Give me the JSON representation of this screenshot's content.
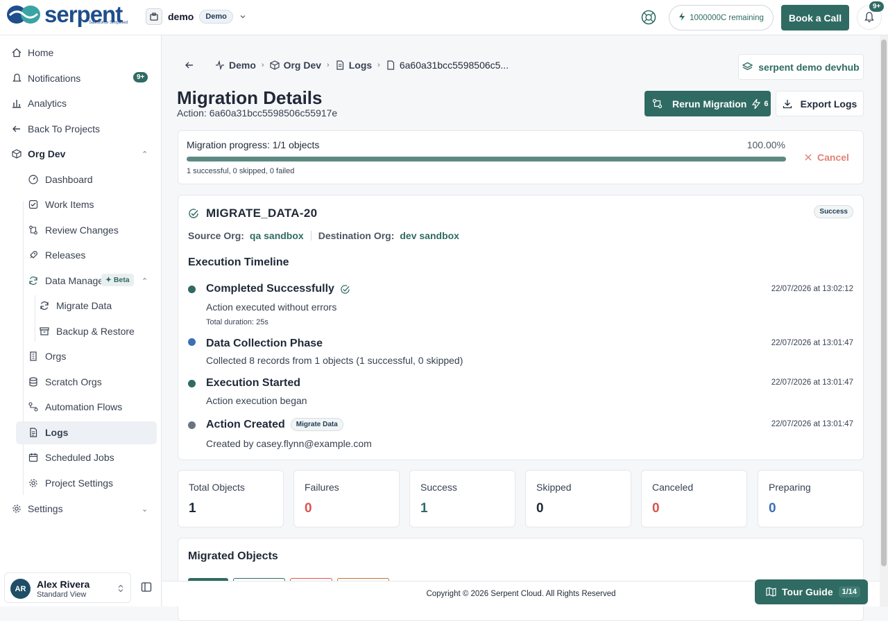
{
  "app": {
    "logo_text": "serpent",
    "logo_tagline": "Salesforce Simplified"
  },
  "workspace": {
    "name": "demo",
    "badge": "Demo"
  },
  "header": {
    "credits": "1000000C remaining",
    "book_call": "Book a Call",
    "bell_badge": "9+"
  },
  "sidebar": {
    "home": "Home",
    "notifications": "Notifications",
    "notifications_badge": "9+",
    "analytics": "Analytics",
    "back": "Back To Projects",
    "org": "Org Dev",
    "items": {
      "dashboard": "Dashboard",
      "work_items": "Work Items",
      "review_changes": "Review Changes",
      "releases": "Releases",
      "data_management": "Data Manage",
      "beta": "Beta",
      "migrate_data": "Migrate Data",
      "backup_restore": "Backup & Restore",
      "orgs": "Orgs",
      "scratch_orgs": "Scratch Orgs",
      "automation_flows": "Automation Flows",
      "logs": "Logs",
      "scheduled_jobs": "Scheduled Jobs",
      "project_settings": "Project Settings"
    },
    "settings": "Settings",
    "user": {
      "initials": "AR",
      "name": "Alex Rivera",
      "role": "Standard View"
    }
  },
  "breadcrumb": {
    "demo": "Demo",
    "org": "Org Dev",
    "logs": "Logs",
    "id": "6a60a31bcc5598506c5..."
  },
  "devhub": "serpent demo devhub",
  "page": {
    "title": "Migration Details",
    "action_label": "Action:",
    "action_id": "6a60a31bcc5598506c55917e",
    "rerun": "Rerun Migration",
    "rerun_count": "6",
    "export": "Export Logs"
  },
  "progress": {
    "label": "Migration progress: 1/1 objects",
    "percent": "100.00%",
    "fraction": 1.0,
    "summary": "1 successful, 0 skipped, 0 failed",
    "cancel": "Cancel"
  },
  "migration": {
    "name": "MIGRATE_DATA-20",
    "status": "Success",
    "source_label": "Source Org:",
    "source": "qa sandbox",
    "dest_label": "Destination Org:",
    "dest": "dev sandbox",
    "timeline_title": "Execution Timeline",
    "events": [
      {
        "title": "Completed Successfully",
        "date": "22/07/2026 at 13:02:12",
        "desc": "Action executed without errors",
        "meta": "Total duration: 25s",
        "color": "#2f6b62"
      },
      {
        "title": "Data Collection Phase",
        "date": "22/07/2026 at 13:01:47",
        "desc": "Collected 8 records from 1 objects (1 successful, 0 skipped)",
        "color": "#3b6fb6"
      },
      {
        "title": "Execution Started",
        "date": "22/07/2026 at 13:01:47",
        "desc": "Action execution began",
        "color": "#2f6b62"
      },
      {
        "title": "Action Created",
        "date": "22/07/2026 at 13:01:47",
        "desc": "Created by casey.flynn@example.com",
        "tag": "Migrate Data",
        "color": "#6b7280"
      }
    ]
  },
  "stats": [
    {
      "label": "Total Objects",
      "value": "1",
      "color": "#1f2937"
    },
    {
      "label": "Failures",
      "value": "0",
      "color": "#d9534f"
    },
    {
      "label": "Success",
      "value": "1",
      "color": "#2f6b62"
    },
    {
      "label": "Skipped",
      "value": "0",
      "color": "#1f2937"
    },
    {
      "label": "Canceled",
      "value": "0",
      "color": "#d9534f"
    },
    {
      "label": "Preparing",
      "value": "0",
      "color": "#3b6fb6"
    }
  ],
  "migrated_objects": {
    "title": "Migrated Objects"
  },
  "footer": "Copyright © 2026 Serpent Cloud. All Rights Reserved",
  "tour": {
    "label": "Tour Guide",
    "count": "1/14"
  }
}
